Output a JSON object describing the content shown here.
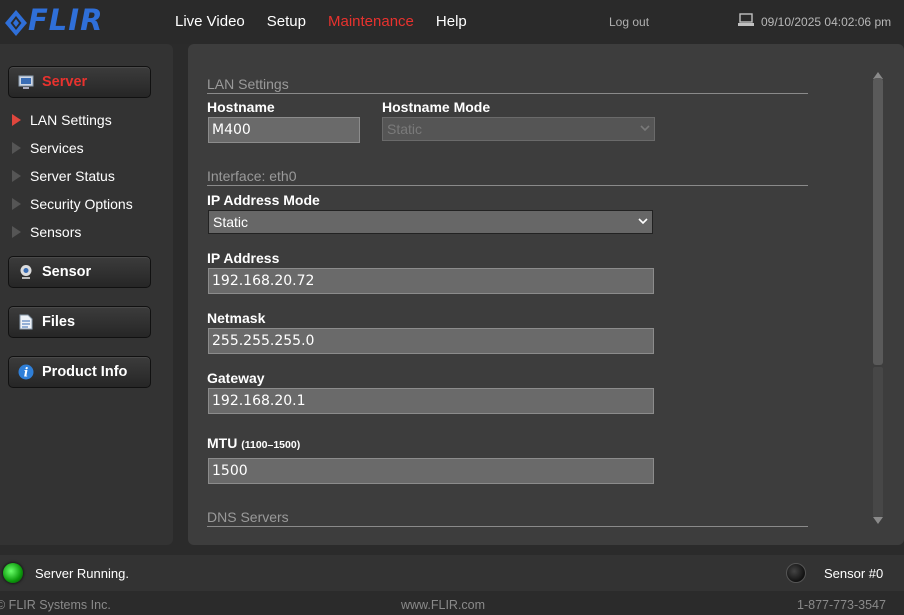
{
  "brand": {
    "logo_text": "FLIR",
    "logo_color": "#2f6fd8"
  },
  "nav": {
    "items": [
      {
        "label": "Live Video"
      },
      {
        "label": "Setup"
      },
      {
        "label": "Maintenance"
      },
      {
        "label": "Help"
      }
    ],
    "active_label": "Maintenance",
    "logout_label": "Log out",
    "datetime": "09/10/2025 04:02:06 pm"
  },
  "sidebar": {
    "server_label": "Server",
    "server_items": [
      {
        "label": "LAN Settings"
      },
      {
        "label": "Services"
      },
      {
        "label": "Server Status"
      },
      {
        "label": "Security Options"
      },
      {
        "label": "Sensors"
      }
    ],
    "sensor_label": "Sensor",
    "files_label": "Files",
    "product_info_label": "Product Info"
  },
  "lan": {
    "section_title": "LAN Settings",
    "hostname_label": "Hostname",
    "hostname_value": "M400",
    "hostname_mode_label": "Hostname Mode",
    "hostname_mode_value": "Static",
    "interface_title": "Interface: eth0",
    "ip_mode_label": "IP Address Mode",
    "ip_mode_value": "Static",
    "ip_label": "IP Address",
    "ip_value": "192.168.20.72",
    "netmask_label": "Netmask",
    "netmask_value": "255.255.255.0",
    "gateway_label": "Gateway",
    "gateway_value": "192.168.20.1",
    "mtu_label": "MTU",
    "mtu_range": "(1100–1500)",
    "mtu_value": "1500",
    "dns_title": "DNS Servers"
  },
  "status": {
    "server_status": "Server Running.",
    "sensor_label": "Sensor #0"
  },
  "footer": {
    "company": "© FLIR Systems Inc.",
    "website": "www.FLIR.com",
    "phone": "1-877-773-3547"
  },
  "colors": {
    "accent_red": "#e8322e",
    "status_green": "#1ec81e"
  }
}
